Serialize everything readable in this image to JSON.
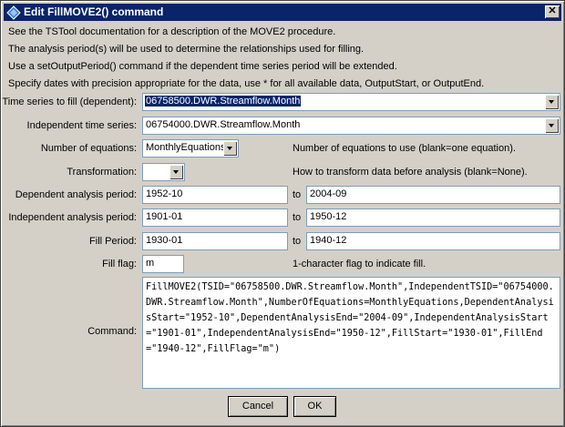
{
  "window": {
    "title": "Edit FillMOVE2() command",
    "close_label": "✕"
  },
  "notes": [
    "See the TSTool documentation for a description of the MOVE2 procedure.",
    "The analysis period(s) will be used to determine the relationships used for filling.",
    "Use a setOutputPeriod() command if the dependent time series period will be extended.",
    "Specify dates with precision appropriate for the data, use * for all available data, OutputStart, or OutputEnd."
  ],
  "form": {
    "ts_fill": {
      "label": "Time series to fill (dependent):",
      "value": "06758500.DWR.Streamflow.Month"
    },
    "independent_ts": {
      "label": "Independent time series:",
      "value": "06754000.DWR.Streamflow.Month"
    },
    "num_equations": {
      "label": "Number of equations:",
      "value": "MonthlyEquations",
      "description": "Number of equations to use (blank=one equation)."
    },
    "transformation": {
      "label": "Transformation:",
      "value": "",
      "description": "How to transform data before analysis (blank=None)."
    },
    "dependent_period": {
      "label": "Dependent analysis period:",
      "start": "1952-10",
      "to": "to",
      "end": "2004-09"
    },
    "independent_period": {
      "label": "Independent analysis period:",
      "start": "1901-01",
      "to": "to",
      "end": "1950-12"
    },
    "fill_period": {
      "label": "Fill Period:",
      "start": "1930-01",
      "to": "to",
      "end": "1940-12"
    },
    "fill_flag": {
      "label": "Fill flag:",
      "value": "m",
      "description": "1-character flag to indicate fill."
    },
    "command": {
      "label": "Command:",
      "value": "FillMOVE2(TSID=\"06758500.DWR.Streamflow.Month\",IndependentTSID=\"06754000.DWR.Streamflow.Month\",NumberOfEquations=MonthlyEquations,DependentAnalysisStart=\"1952-10\",DependentAnalysisEnd=\"2004-09\",IndependentAnalysisStart=\"1901-01\",IndependentAnalysisEnd=\"1950-12\",FillStart=\"1930-01\",FillEnd=\"1940-12\",FillFlag=\"m\")"
    }
  },
  "buttons": {
    "cancel": "Cancel",
    "ok": "OK"
  },
  "colors": {
    "titlebar": "#0a246a",
    "dialog_bg": "#d4d0c8",
    "selection": "#0a246a"
  }
}
